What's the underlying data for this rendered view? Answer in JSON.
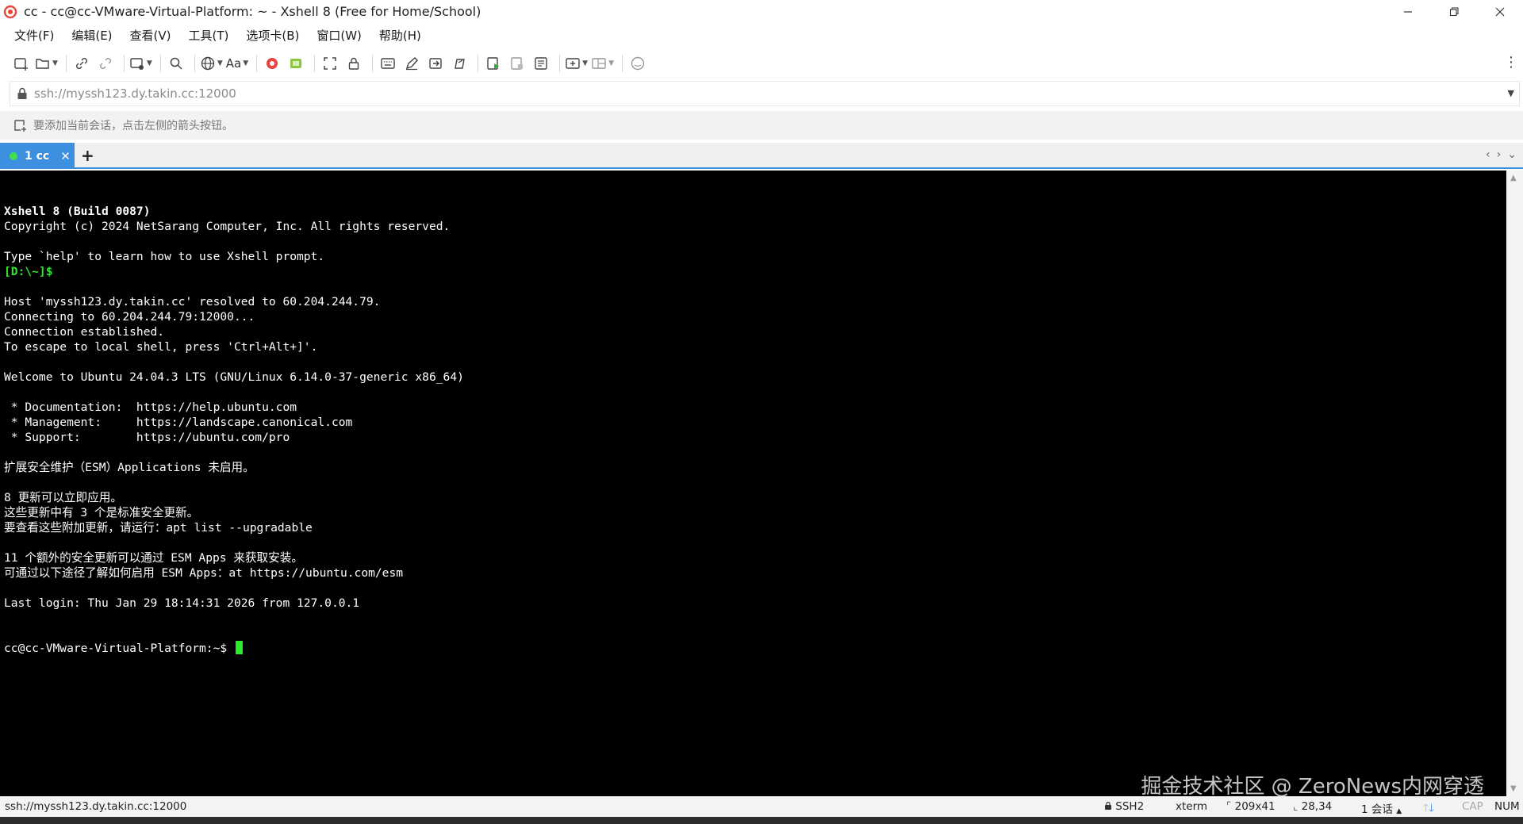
{
  "window": {
    "title": "cc - cc@cc-VMware-Virtual-Platform: ~ - Xshell 8 (Free for Home/School)"
  },
  "menu": [
    {
      "label": "文件(F)"
    },
    {
      "label": "编辑(E)"
    },
    {
      "label": "查看(V)"
    },
    {
      "label": "工具(T)"
    },
    {
      "label": "选项卡(B)"
    },
    {
      "label": "窗口(W)"
    },
    {
      "label": "帮助(H)"
    }
  ],
  "toolbar": {
    "font_label": "Aa"
  },
  "address": {
    "value": "ssh://myssh123.dy.takin.cc:12000"
  },
  "hint": {
    "text": "要添加当前会话，点击左侧的箭头按钮。"
  },
  "tabs": [
    {
      "label": "1 cc",
      "active": true
    }
  ],
  "terminal": {
    "lines": [
      {
        "text": "Xshell 8 (Build 0087)",
        "style": "bold"
      },
      {
        "text": "Copyright (c) 2024 NetSarang Computer, Inc. All rights reserved.",
        "style": "normal"
      },
      {
        "text": "",
        "style": "normal"
      },
      {
        "text": "Type `help' to learn how to use Xshell prompt.",
        "style": "normal"
      },
      {
        "text": "[D:\\~]$",
        "style": "green"
      },
      {
        "text": "",
        "style": "normal"
      },
      {
        "text": "Host 'myssh123.dy.takin.cc' resolved to 60.204.244.79.",
        "style": "normal"
      },
      {
        "text": "Connecting to 60.204.244.79:12000...",
        "style": "normal"
      },
      {
        "text": "Connection established.",
        "style": "normal"
      },
      {
        "text": "To escape to local shell, press 'Ctrl+Alt+]'.",
        "style": "normal"
      },
      {
        "text": "",
        "style": "normal"
      },
      {
        "text": "Welcome to Ubuntu 24.04.3 LTS (GNU/Linux 6.14.0-37-generic x86_64)",
        "style": "normal"
      },
      {
        "text": "",
        "style": "normal"
      },
      {
        "text": " * Documentation:  https://help.ubuntu.com",
        "style": "normal"
      },
      {
        "text": " * Management:     https://landscape.canonical.com",
        "style": "normal"
      },
      {
        "text": " * Support:        https://ubuntu.com/pro",
        "style": "normal"
      },
      {
        "text": "",
        "style": "normal"
      },
      {
        "text": "扩展安全维护（ESM）Applications 未启用。",
        "style": "normal"
      },
      {
        "text": "",
        "style": "normal"
      },
      {
        "text": "8 更新可以立即应用。",
        "style": "normal"
      },
      {
        "text": "这些更新中有 3 个是标准安全更新。",
        "style": "normal"
      },
      {
        "text": "要查看这些附加更新，请运行：apt list --upgradable",
        "style": "normal"
      },
      {
        "text": "",
        "style": "normal"
      },
      {
        "text": "11 个额外的安全更新可以通过 ESM Apps 来获取安装。",
        "style": "normal"
      },
      {
        "text": "可通过以下途径了解如何启用 ESM Apps：at https://ubuntu.com/esm",
        "style": "normal"
      },
      {
        "text": "",
        "style": "normal"
      },
      {
        "text": "Last login: Thu Jan 29 18:14:31 2026 from 127.0.0.1",
        "style": "normal"
      }
    ],
    "prompt": "cc@cc-VMware-Virtual-Platform:~$ ",
    "cursor_color": "#2ee82e",
    "watermark": "掘金技术社区 @ ZeroNews内网穿透"
  },
  "status": {
    "address": "ssh://myssh123.dy.takin.cc:12000",
    "protocol": "SSH2",
    "terminal_type": "xterm",
    "size": "209x41",
    "cursor_pos": "28,34",
    "sessions": "1 会话",
    "cap": "CAP",
    "num": "NUM"
  },
  "colors": {
    "tab_active": "#3d8fe0",
    "terminal_bg": "#000000",
    "prompt_green": "#2ee82e"
  }
}
